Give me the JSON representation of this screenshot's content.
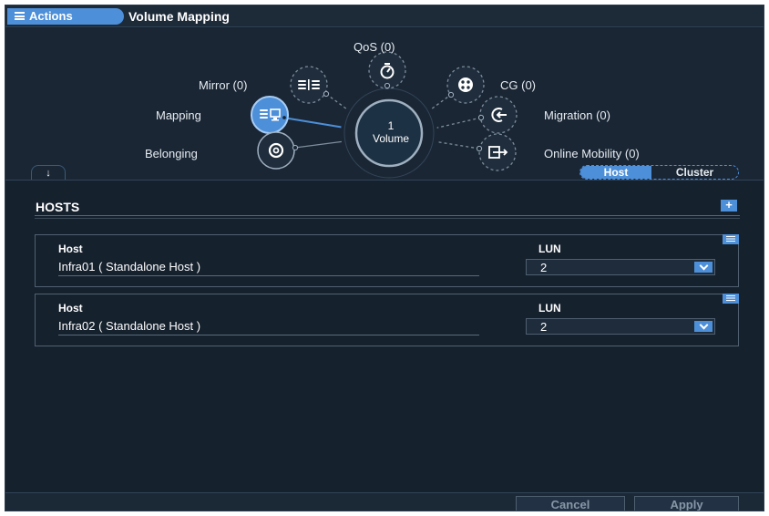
{
  "titlebar": {
    "actions_label": "Actions",
    "title": "Volume Mapping"
  },
  "diagram": {
    "hub": {
      "count": "1",
      "label": "Volume"
    },
    "nodes": {
      "qos": {
        "label": "QoS (0)",
        "icon": "qos-icon",
        "active": false
      },
      "mirror": {
        "label": "Mirror (0)",
        "icon": "mirror-icon",
        "active": false
      },
      "cg": {
        "label": "CG (0)",
        "icon": "cg-icon",
        "active": false
      },
      "mapping": {
        "label": "Mapping",
        "icon": "mapping-icon",
        "active": true
      },
      "migration": {
        "label": "Migration (0)",
        "icon": "migration-icon",
        "active": false
      },
      "belonging": {
        "label": "Belonging",
        "icon": "belonging-icon",
        "active": false
      },
      "online_mobility": {
        "label": "Online Mobility (0)",
        "icon": "online-mobility-icon",
        "active": false
      }
    }
  },
  "collapse_icon": "↓",
  "view_toggle": {
    "options": [
      "Host",
      "Cluster"
    ],
    "selected": "Host"
  },
  "hosts_section": {
    "title": "HOSTS",
    "add_icon": "+",
    "host_header": "Host",
    "lun_header": "LUN",
    "rows": [
      {
        "host": "Infra01 ( Standalone Host )",
        "lun": "2"
      },
      {
        "host": "Infra02 ( Standalone Host )",
        "lun": "2"
      }
    ]
  },
  "footer": {
    "cancel_label": "Cancel",
    "apply_label": "Apply"
  },
  "colors": {
    "accent": "#4d8fd8",
    "background": "#16212e",
    "node_dashed": "#7d8d9c",
    "hub_border": "#9fb0c0"
  }
}
